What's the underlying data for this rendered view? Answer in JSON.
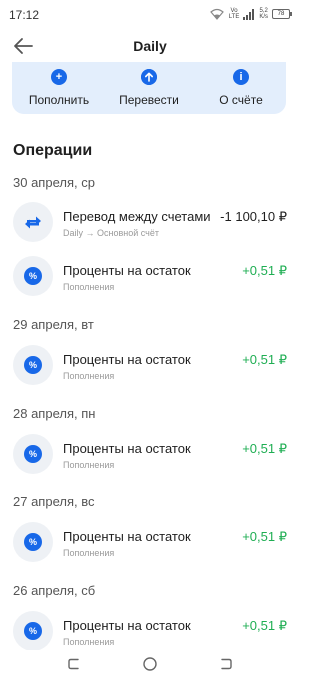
{
  "status": {
    "time": "17:12",
    "network_top": "Vo",
    "network_bottom": "LTE",
    "speed_value": "5,2",
    "speed_unit": "K/s",
    "battery": "78"
  },
  "header": {
    "title": "Daily"
  },
  "actions": [
    {
      "label": "Пополнить",
      "icon": "plus-icon"
    },
    {
      "label": "Перевести",
      "icon": "arrow-up-icon"
    },
    {
      "label": "О счёте",
      "icon": "info-icon"
    }
  ],
  "section_title": "Операции",
  "groups": [
    {
      "date": "30 апреля, ср",
      "operations": [
        {
          "name": "Перевод между счетами",
          "sub": "Daily → Основной счёт",
          "amount": "-1 100,10 ₽",
          "icon": "transfer-icon",
          "color": "#1f1f1f"
        },
        {
          "name": "Проценты на остаток",
          "sub": "Пополнения",
          "amount": "+0,51 ₽",
          "icon": "percent-icon",
          "color": "#1fae53"
        }
      ]
    },
    {
      "date": "29 апреля, вт",
      "operations": [
        {
          "name": "Проценты на остаток",
          "sub": "Пополнения",
          "amount": "+0,51 ₽",
          "icon": "percent-icon",
          "color": "#1fae53"
        }
      ]
    },
    {
      "date": "28 апреля, пн",
      "operations": [
        {
          "name": "Проценты на остаток",
          "sub": "Пополнения",
          "amount": "+0,51 ₽",
          "icon": "percent-icon",
          "color": "#1fae53"
        }
      ]
    },
    {
      "date": "27 апреля, вс",
      "operations": [
        {
          "name": "Проценты на остаток",
          "sub": "Пополнения",
          "amount": "+0,51 ₽",
          "icon": "percent-icon",
          "color": "#1fae53"
        }
      ]
    },
    {
      "date": "26 апреля, сб",
      "operations": [
        {
          "name": "Проценты на остаток",
          "sub": "Пополнения",
          "amount": "+0,51 ₽",
          "icon": "percent-icon",
          "color": "#1fae53"
        }
      ]
    }
  ],
  "colors": {
    "accent": "#1868e8",
    "action_bar_bg": "#e3eefc",
    "positive": "#1fae53"
  }
}
